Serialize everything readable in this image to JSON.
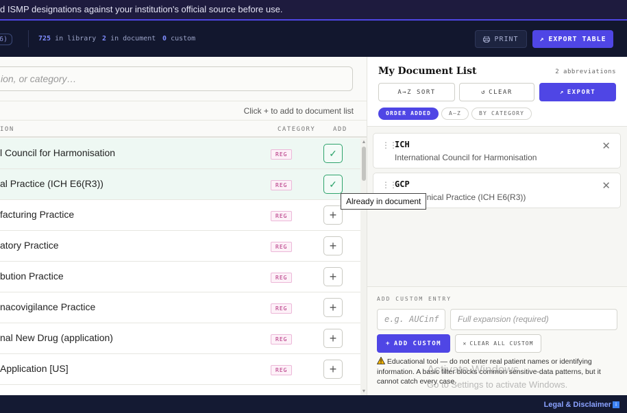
{
  "banner": {
    "text": "d ISMP designations against your institution's official source before use."
  },
  "topbar": {
    "partial_badge": "6)",
    "library_count": "725",
    "library_label": "in library",
    "document_count": "2",
    "document_label": "in document",
    "custom_count": "0",
    "custom_label": "custom",
    "print_label": "PRINT",
    "export_table_label": "EXPORT TABLE"
  },
  "left": {
    "search_placeholder": "ion, or category…",
    "hint": "Click + to add to document list",
    "columns": {
      "expansion": "ION",
      "category": "CATEGORY",
      "add": "ADD"
    },
    "rows": [
      {
        "text": "l Council for Harmonisation",
        "category": "REG",
        "added": true
      },
      {
        "text": "al Practice (ICH E6(R3))",
        "category": "REG",
        "added": true
      },
      {
        "text": "facturing Practice",
        "category": "REG",
        "added": false
      },
      {
        "text": "atory Practice",
        "category": "REG",
        "added": false
      },
      {
        "text": "bution Practice",
        "category": "REG",
        "added": false
      },
      {
        "text": "nacovigilance Practice",
        "category": "REG",
        "added": false
      },
      {
        "text": "nal New Drug (application)",
        "category": "REG",
        "added": false
      },
      {
        "text": "Application [US]",
        "category": "REG",
        "added": false
      }
    ],
    "tooltip": "Already in document"
  },
  "right": {
    "title": "My Document List",
    "count": "2 abbreviations",
    "sort_label": "A→Z SORT",
    "clear_label": "CLEAR",
    "export_label": "EXPORT",
    "tabs": [
      "ORDER ADDED",
      "A–Z",
      "BY CATEGORY"
    ],
    "items": [
      {
        "abbr": "ICH",
        "expansion": "International Council for Harmonisation"
      },
      {
        "abbr": "GCP",
        "expansion": "Good Clinical Practice (ICH E6(R3))"
      }
    ],
    "custom_section_label": "ADD CUSTOM ENTRY",
    "abbr_placeholder": "e.g. AUCinf",
    "expansion_placeholder": "Full expansion (required)",
    "add_custom_label": "ADD CUSTOM",
    "clear_custom_label": "CLEAR ALL CUSTOM",
    "note": "Educational tool — do not enter real patient names or identifying information. A basic filter blocks common sensitive-data patterns, but it cannot catch every case."
  },
  "overlay": {
    "activate_title": "Activate Windows",
    "activate_sub": "Go to Settings to activate Windows."
  },
  "footer": {
    "legal_label": "Legal & Disclaimer",
    "info_glyph": "i"
  },
  "icons": {
    "print": "printer-icon",
    "export": "arrow-up-right-icon",
    "clear": "refresh-icon",
    "add": "plus-icon",
    "check": "check-icon",
    "close": "close-icon",
    "grip": "drag-handle-icon",
    "warning": "warning-icon"
  },
  "colors": {
    "accent": "#4f46e5",
    "topbar": "#12172e",
    "added_row": "#eef8f3",
    "category_tag": "#b0267a",
    "check": "#2da36b"
  }
}
